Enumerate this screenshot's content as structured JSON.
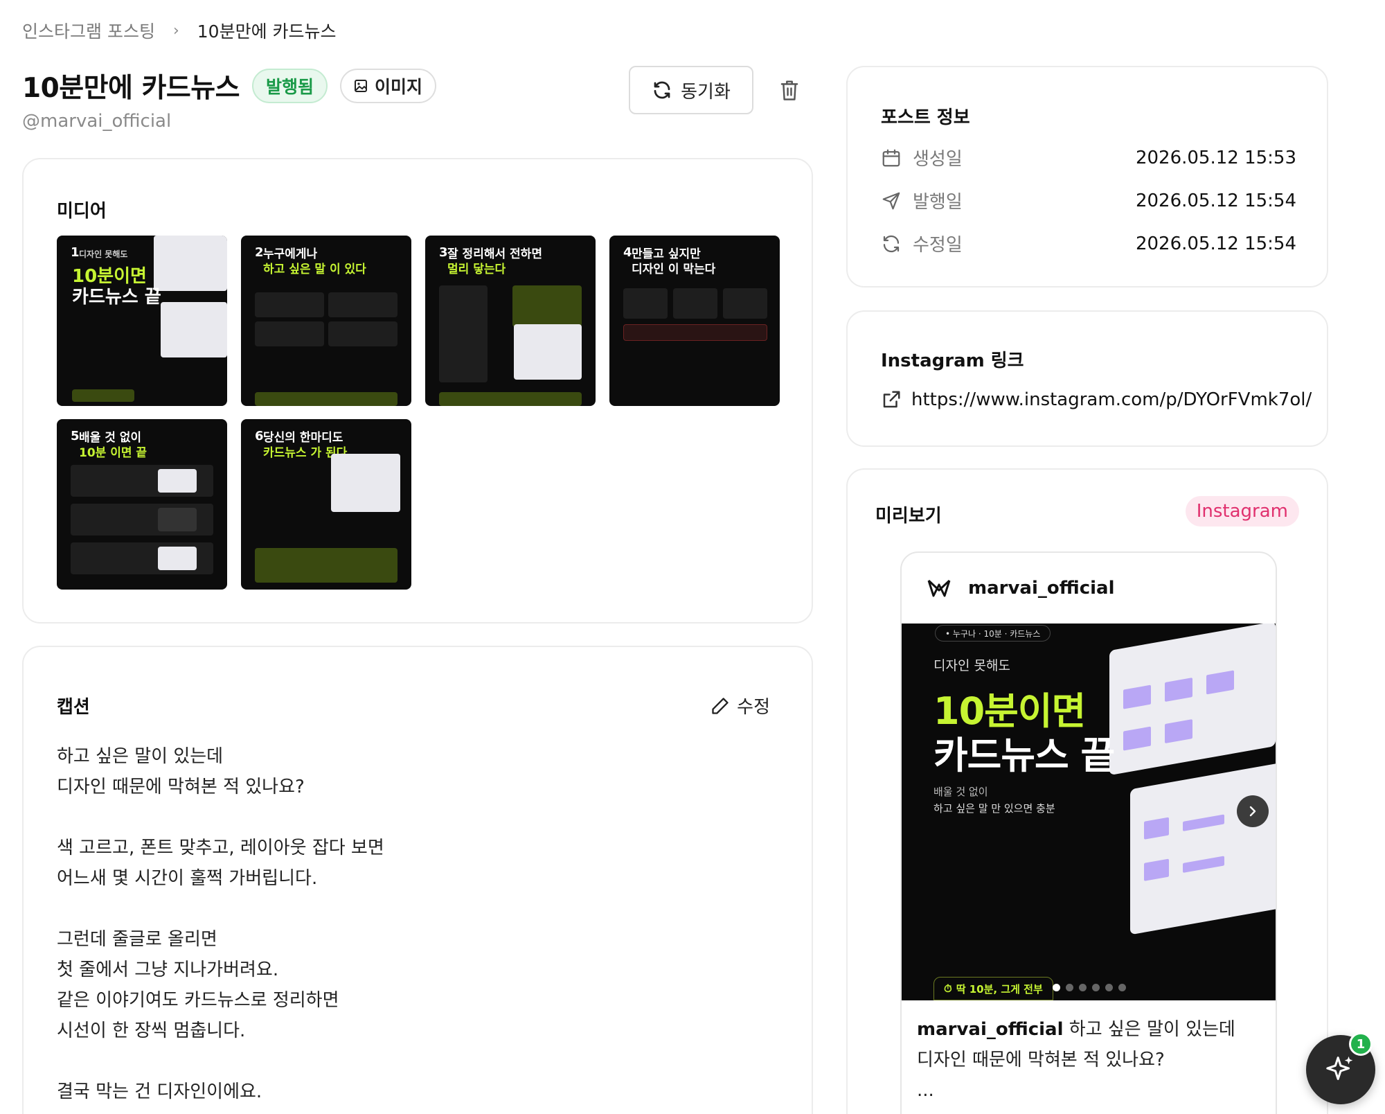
{
  "breadcrumb": {
    "parent": "인스타그램 포스팅",
    "separator": "›",
    "current": "10분만에 카드뉴스"
  },
  "header": {
    "title": "10분만에 카드뉴스",
    "status_badge": "발행됨",
    "type_badge": "이미지",
    "handle": "@marvai_official",
    "sync_label": "동기화"
  },
  "media": {
    "title": "미디어",
    "thumbnails": [
      {
        "num": "1",
        "line1": "디자인 못해도",
        "line2": "10분이면",
        "line3": "카드뉴스 끝"
      },
      {
        "num": "2",
        "line1": "누구에게나",
        "line2": "하고 싶은 말 이 있다"
      },
      {
        "num": "3",
        "line1": "잘 정리해서 전하면",
        "line2": "멀리 닿는다"
      },
      {
        "num": "4",
        "line1": "만들고 싶지만",
        "line2": "디자인 이 막는다"
      },
      {
        "num": "5",
        "line1": "배울 것 없이",
        "line2": "10분 이면 끝"
      },
      {
        "num": "6",
        "line1": "당신의 한마디도",
        "line2": "카드뉴스 가 된다"
      }
    ]
  },
  "caption": {
    "title": "캡션",
    "edit_label": "수정",
    "lines": [
      "하고 싶은 말이 있는데",
      "디자인 때문에 막혀본 적 있나요?",
      "",
      "색 고르고, 폰트 맞추고, 레이아웃 잡다 보면",
      "어느새 몇 시간이 훌쩍 가버립니다.",
      "",
      "그런데 줄글로 올리면",
      "첫 줄에서 그냥 지나가버려요.",
      "같은 이야기여도 카드뉴스로 정리하면",
      "시선이 한 장씩 멈춥니다.",
      "",
      "결국 막는 건 디자인이에요."
    ]
  },
  "post_info": {
    "title": "포스트 정보",
    "created_label": "생성일",
    "created_value": "2026.05.12 15:53",
    "published_label": "발행일",
    "published_value": "2026.05.12 15:54",
    "modified_label": "수정일",
    "modified_value": "2026.05.12 15:54"
  },
  "instagram_link": {
    "title": "Instagram 링크",
    "url": "https://www.instagram.com/p/DYOrFVmk7ol/"
  },
  "preview": {
    "title": "미리보기",
    "platform_badge": "Instagram",
    "username": "marvai_official",
    "image": {
      "pill": "• 누구나 · 10분 · 카드뉴스",
      "small": "디자인 못해도",
      "big1": "10분이면",
      "big2": "카드뉴스 끝",
      "sub1": "배울 것 없이",
      "sub2": "하고 싶은 말 만 있으면 충분",
      "footer": "딱 10분, 그게 전부"
    },
    "slide_count": 6,
    "active_slide": 1,
    "caption_user": "marvai_official",
    "caption_line1": "하고 싶은 말이 있는데",
    "caption_line2": "디자인 때문에 막혀본 적 있나요?",
    "caption_more": "..."
  },
  "fab": {
    "badge_count": "1"
  },
  "colors": {
    "published_green": "#1a9a48",
    "instagram_pink": "#e0306e",
    "lime_accent": "#c6f432"
  }
}
